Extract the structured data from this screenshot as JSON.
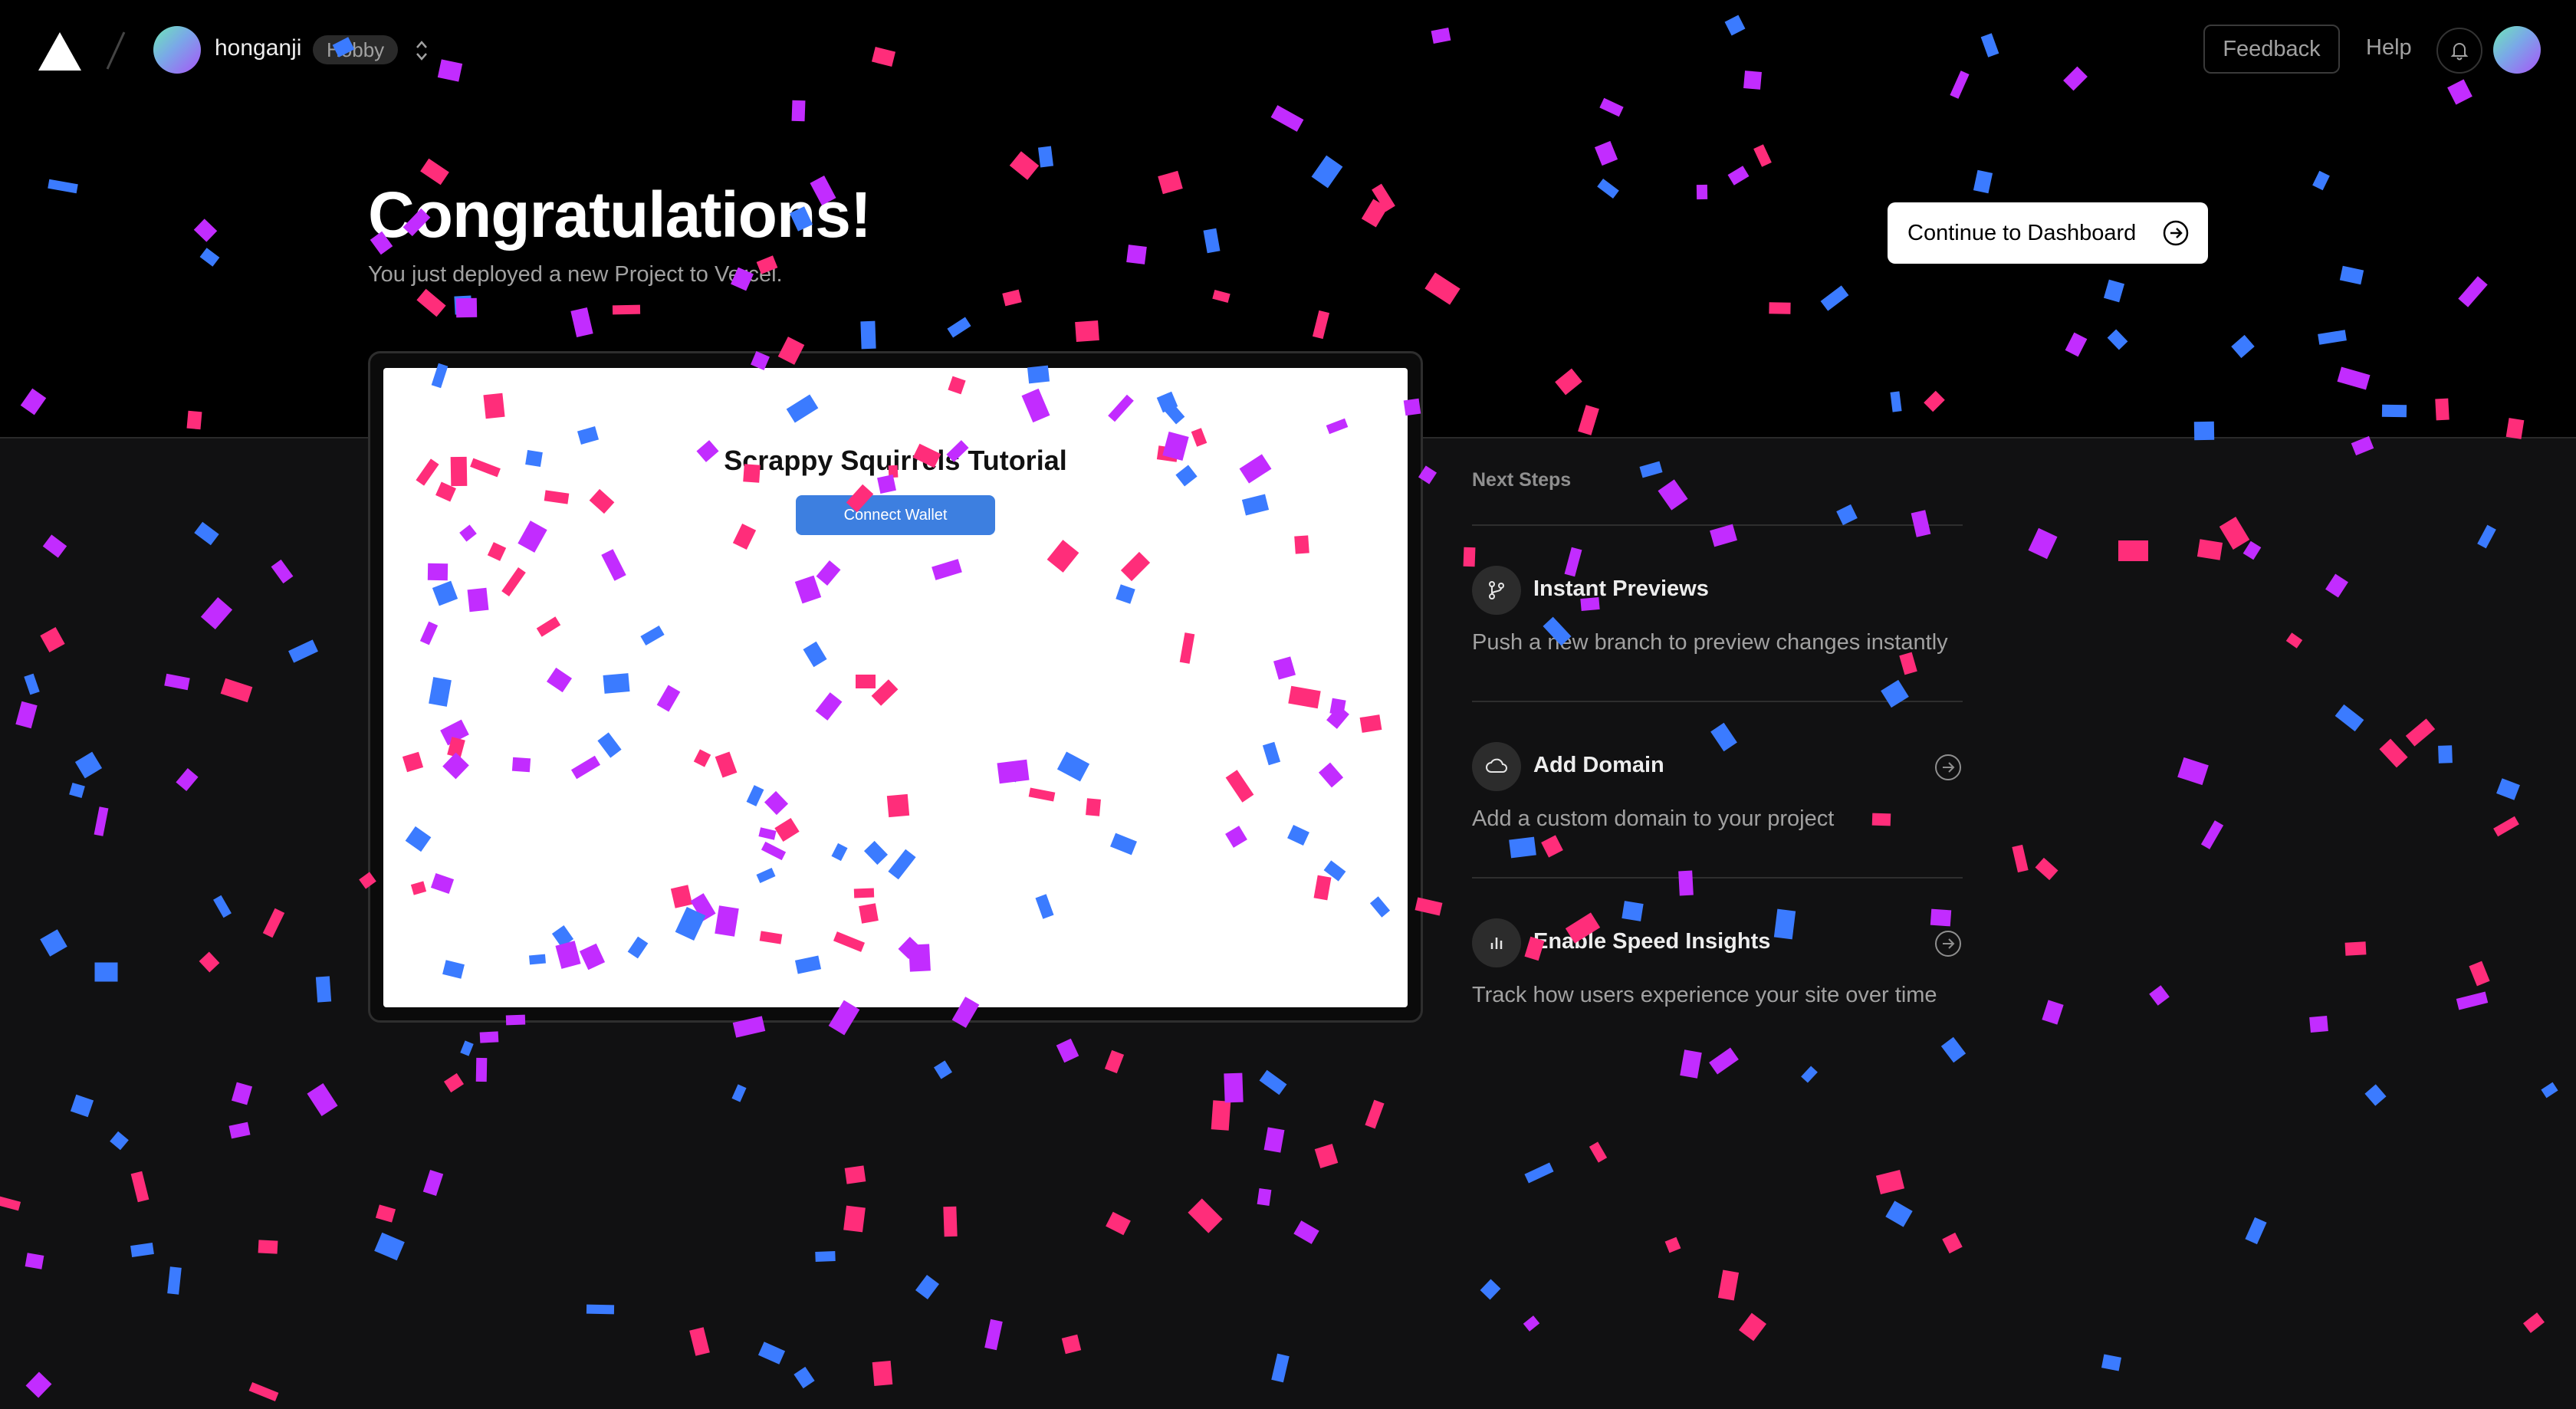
{
  "header": {
    "team_name": "honganji",
    "plan_badge": "Hobby",
    "feedback_label": "Feedback",
    "help_label": "Help",
    "icons": [
      "vercel-logo-icon",
      "chevron-up-down-icon",
      "bell-icon"
    ]
  },
  "hero": {
    "title": "Congratulations!",
    "subtitle": "You just deployed a new Project to Vercel.",
    "dashboard_button_label": "Continue to Dashboard"
  },
  "preview": {
    "title": "Scrappy Squirrels Tutorial",
    "button_label": "Connect Wallet"
  },
  "next_steps": {
    "heading": "Next Steps",
    "items": [
      {
        "title": "Instant Previews",
        "description": "Push a new branch to preview changes instantly",
        "icon": "git-branch-icon"
      },
      {
        "title": "Add Domain",
        "description": "Add a custom domain to your project",
        "icon": "cloud-icon"
      },
      {
        "title": "Enable Speed Insights",
        "description": "Track how users experience your site over time",
        "icon": "bar-chart-icon"
      }
    ]
  },
  "colors": {
    "confetti": [
      "#ff2d7a",
      "#3b7bff",
      "#c22cff"
    ],
    "accent_button": "#3d7fe0",
    "background_top": "#000000",
    "background_bottom": "#111112"
  }
}
